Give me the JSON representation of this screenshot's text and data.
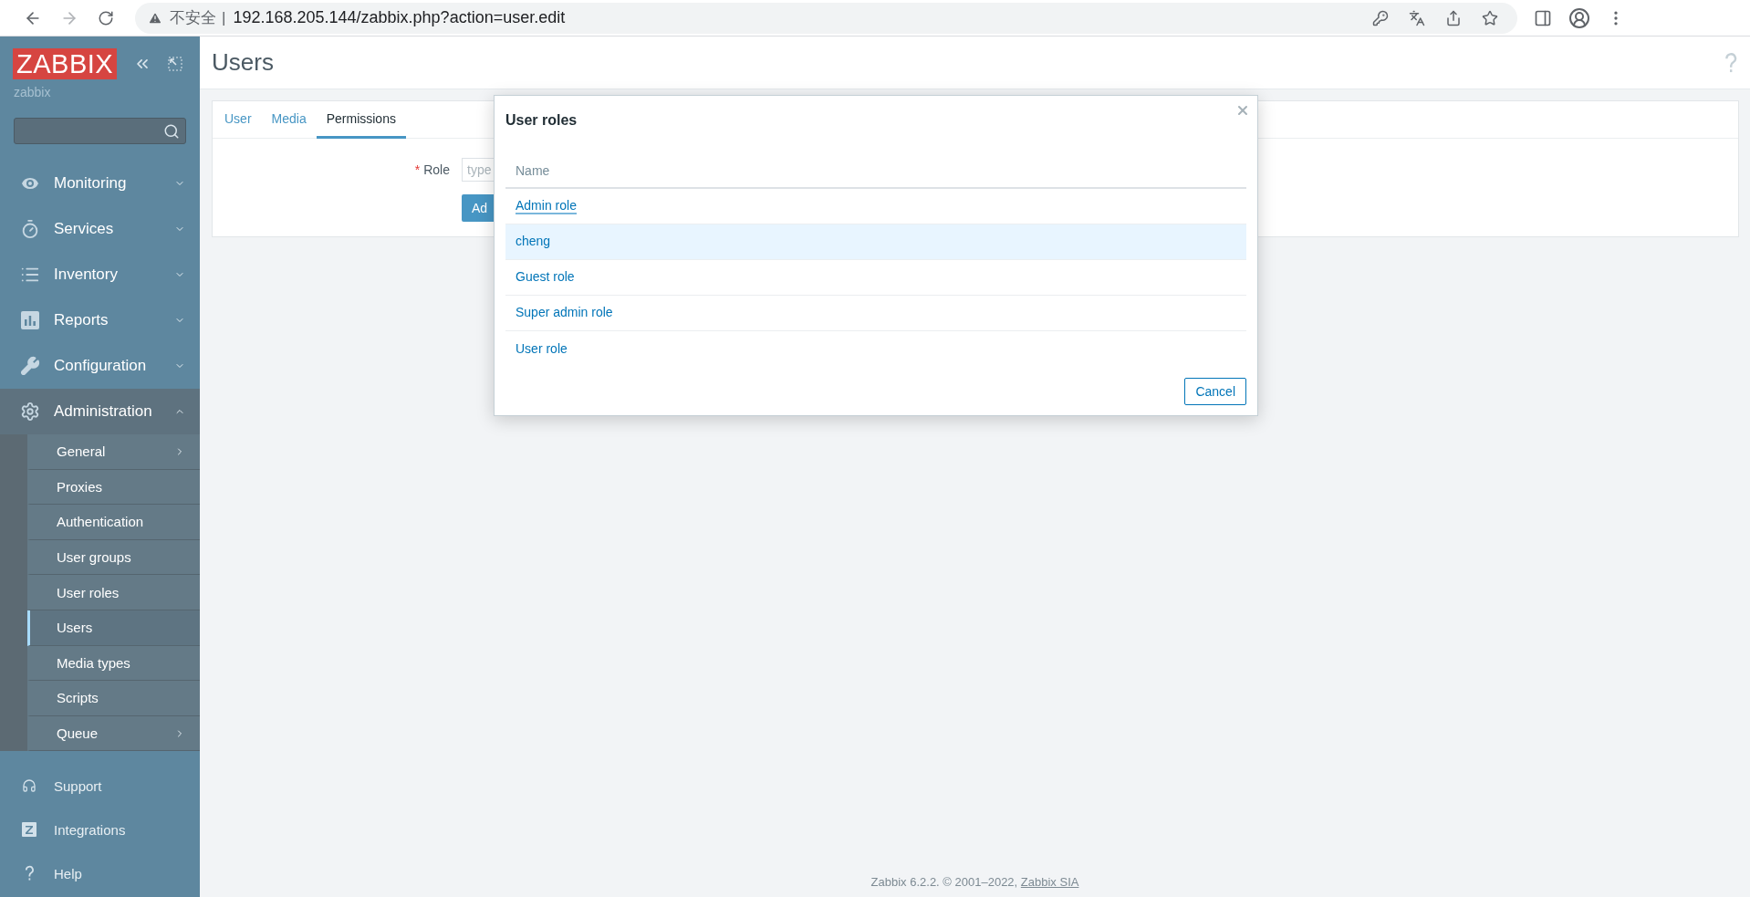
{
  "browser": {
    "security_label": "不安全",
    "separator": "|",
    "url": "192.168.205.144/zabbix.php?action=user.edit"
  },
  "sidebar": {
    "logo": "ZABBIX",
    "server_name": "zabbix",
    "menu": [
      {
        "label": "Monitoring",
        "expanded": false
      },
      {
        "label": "Services",
        "expanded": false
      },
      {
        "label": "Inventory",
        "expanded": false
      },
      {
        "label": "Reports",
        "expanded": false
      },
      {
        "label": "Configuration",
        "expanded": false
      },
      {
        "label": "Administration",
        "expanded": true,
        "children": [
          {
            "label": "General",
            "selected": false,
            "has_submenu": true
          },
          {
            "label": "Proxies",
            "selected": false,
            "has_submenu": false
          },
          {
            "label": "Authentication",
            "selected": false,
            "has_submenu": false
          },
          {
            "label": "User groups",
            "selected": false,
            "has_submenu": false
          },
          {
            "label": "User roles",
            "selected": false,
            "has_submenu": false
          },
          {
            "label": "Users",
            "selected": true,
            "has_submenu": false
          },
          {
            "label": "Media types",
            "selected": false,
            "has_submenu": false
          },
          {
            "label": "Scripts",
            "selected": false,
            "has_submenu": false
          },
          {
            "label": "Queue",
            "selected": false,
            "has_submenu": true
          }
        ]
      }
    ],
    "footer_items": [
      {
        "label": "Support"
      },
      {
        "label": "Integrations"
      },
      {
        "label": "Help"
      }
    ]
  },
  "page": {
    "title": "Users"
  },
  "tabs": [
    {
      "label": "User",
      "selected": false
    },
    {
      "label": "Media",
      "selected": false
    },
    {
      "label": "Permissions",
      "selected": true
    }
  ],
  "form": {
    "required_mark": "*",
    "role_label": "Role",
    "role_placeholder": "type",
    "add_button": "Ad"
  },
  "dialog": {
    "title": "User roles",
    "column": "Name",
    "rows": [
      {
        "name": "Admin role",
        "focused": true,
        "highlighted": false
      },
      {
        "name": "cheng",
        "focused": false,
        "highlighted": true
      },
      {
        "name": "Guest role",
        "focused": false,
        "highlighted": false
      },
      {
        "name": "Super admin role",
        "focused": false,
        "highlighted": false
      },
      {
        "name": "User role",
        "focused": false,
        "highlighted": false
      }
    ],
    "cancel": "Cancel"
  },
  "footer": {
    "text": "Zabbix 6.2.2. © 2001–2022, ",
    "link": "Zabbix SIA"
  }
}
